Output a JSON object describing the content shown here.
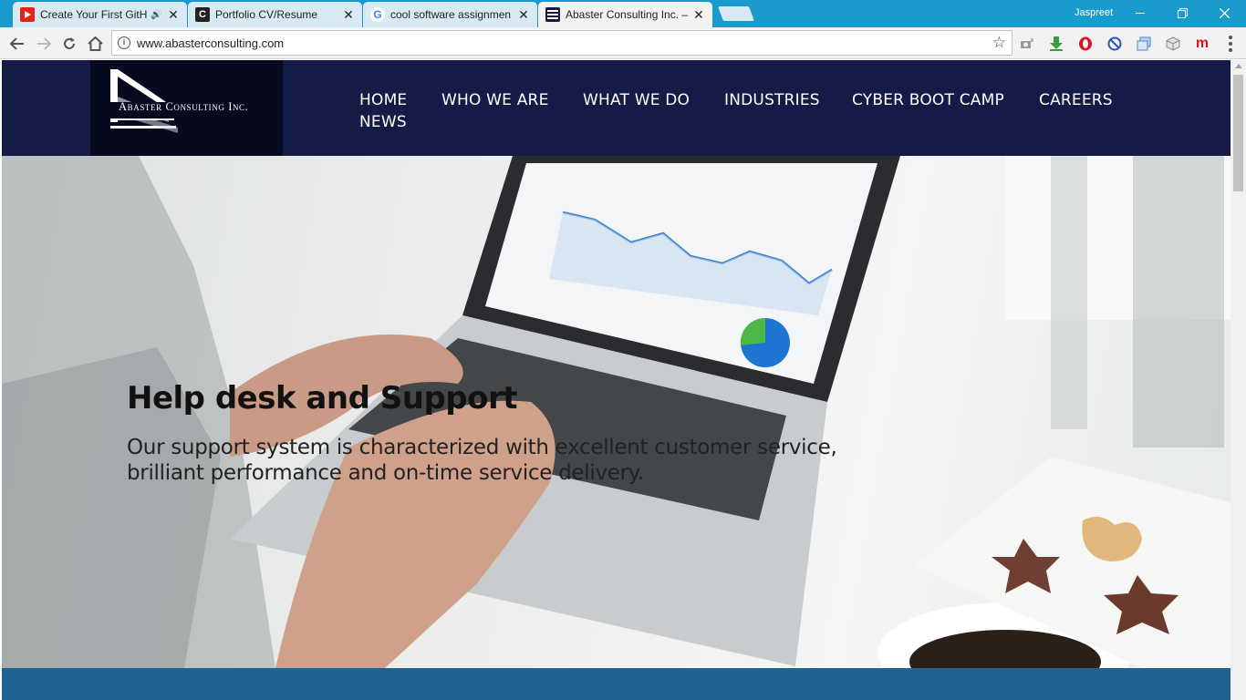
{
  "browser": {
    "tabs": [
      {
        "title": "Create Your First GitH",
        "favicon": "youtube-icon",
        "audio": true
      },
      {
        "title": "Portfolio CV/Resume",
        "favicon": "portfolio-c-icon",
        "audio": false
      },
      {
        "title": "cool software assignmen",
        "favicon": "google-icon",
        "audio": false
      },
      {
        "title": "Abaster Consulting Inc. –",
        "favicon": "abaster-favicon",
        "audio": false,
        "active": true
      }
    ],
    "close_glyph": "✕",
    "profile_name": "Jaspreet",
    "url": "www.abasterconsulting.com",
    "extensions": [
      "camera-extension-icon",
      "download-extension-icon",
      "opera-icon",
      "block-icon",
      "screenshot-extension-icon",
      "cube-extension-icon",
      "m-extension-icon"
    ],
    "m_extension_label": "m"
  },
  "site": {
    "logo_text": "Abaster Consulting Inc.",
    "nav": [
      "HOME",
      "WHO WE ARE",
      "WHAT WE DO",
      "INDUSTRIES",
      "CYBER BOOT CAMP",
      "CAREERS",
      "NEWS"
    ]
  },
  "hero": {
    "headline": "Help desk and Support",
    "subtext": "Our support system is characterized with excellent customer service, brilliant performance and on-time service delivery."
  },
  "colors": {
    "titlebar": "#1a9bcd",
    "header_bg": "#141b46",
    "logo_bg": "#070a1e",
    "bottom_band": "#1d6394"
  }
}
